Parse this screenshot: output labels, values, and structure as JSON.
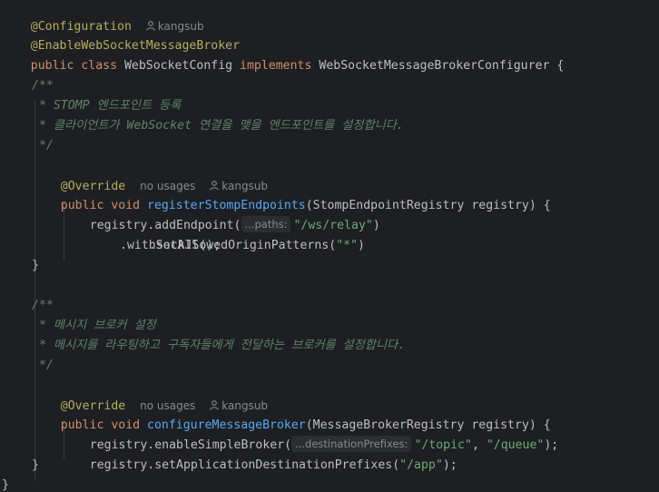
{
  "code": {
    "l1": {
      "ann": "@Configuration",
      "author": "kangsub"
    },
    "l2": {
      "ann": "@EnableWebSocketMessageBroker"
    },
    "l3": {
      "kw": "public class ",
      "name": "WebSocketConfig ",
      "kw2": "implements ",
      "iface": "WebSocketMessageBrokerConfigurer {"
    },
    "l5": "/**",
    "l6": " * STOMP 엔드포인트 등록",
    "l7": " * 클라이언트가 WebSocket 연결을 맺을 엔드포인트를 설정합니다.",
    "l8": " */",
    "l9": {
      "ann": "@Override",
      "usages": "no usages",
      "author": "kangsub"
    },
    "l10": {
      "kw": "public void ",
      "fn": "registerStompEndpoints",
      "rest": "(StompEndpointRegistry registry) {"
    },
    "l11": {
      "pre": "registry.addEndpoint(",
      "hint": "...paths:",
      "str": "\"/ws/relay\"",
      "post": ")"
    },
    "l12": {
      "pre": ".setAllowedOriginPatterns(",
      "str": "\"*\"",
      "post": ")"
    },
    "l13": ".withSockJS();",
    "l14": "}",
    "l16": "/**",
    "l17": " * 메시지 브로커 설정",
    "l18": " * 메시지를 라우팅하고 구독자들에게 전달하는 브로커를 설정합니다.",
    "l19": " */",
    "l20": {
      "ann": "@Override",
      "usages": "no usages",
      "author": "kangsub"
    },
    "l21": {
      "kw": "public void ",
      "fn": "configureMessageBroker",
      "rest": "(MessageBrokerRegistry registry) {"
    },
    "l22": {
      "pre": "registry.enableSimpleBroker(",
      "hint": "...destinationPrefixes:",
      "str1": "\"/topic\"",
      "sep": ", ",
      "str2": "\"/queue\"",
      "post": ");"
    },
    "l23": {
      "pre": "registry.setApplicationDestinationPrefixes(",
      "str": "\"/app\"",
      "post": ");"
    },
    "l24": "}",
    "l25": "}"
  },
  "icons": {
    "author": "person-icon"
  },
  "colors": {
    "background": "#1e1f22",
    "annotation": "#b3ae60",
    "keyword": "#cf8e6d",
    "method": "#56a8f5",
    "string": "#6aab73",
    "doc_comment": "#5f826b",
    "text": "#bcbec4",
    "hint": "#868a91"
  }
}
